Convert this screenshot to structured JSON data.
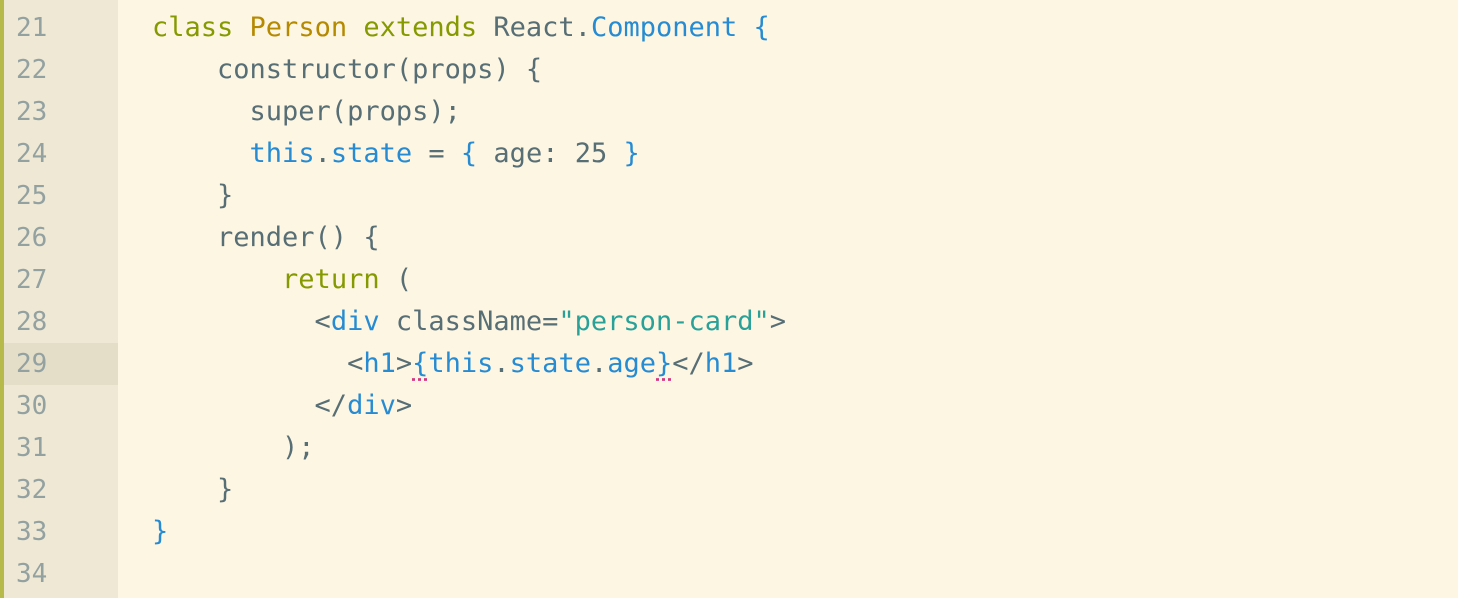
{
  "editor": {
    "colors": {
      "background": "#fdf6e3",
      "gutter": "#eee8d5",
      "active_line_gutter": "#e4ddc8",
      "gutter_accent": "#b5ba4a",
      "keyword": "#859900",
      "class_name": "#b58900",
      "identifier_blue": "#268bd2",
      "string": "#2aa198",
      "plain": "#586e75",
      "line_number": "#93a1a1",
      "lint_squiggle": "#d33682"
    },
    "active_line": 29,
    "lines": [
      {
        "number": "21",
        "tokens": [
          {
            "t": "class",
            "k": "keyword"
          },
          {
            "t": " ",
            "k": "plain"
          },
          {
            "t": "Person",
            "k": "class"
          },
          {
            "t": " ",
            "k": "plain"
          },
          {
            "t": "extends",
            "k": "keyword"
          },
          {
            "t": " React.",
            "k": "plain"
          },
          {
            "t": "Component",
            "k": "type"
          },
          {
            "t": " ",
            "k": "plain"
          },
          {
            "t": "{",
            "k": "brace"
          }
        ]
      },
      {
        "number": "22",
        "tokens": [
          {
            "t": "    constructor(props) {",
            "k": "plain"
          }
        ]
      },
      {
        "number": "23",
        "tokens": [
          {
            "t": "      super(props);",
            "k": "plain"
          }
        ]
      },
      {
        "number": "24",
        "tokens": [
          {
            "t": "      ",
            "k": "plain"
          },
          {
            "t": "this",
            "k": "this"
          },
          {
            "t": ".",
            "k": "plain"
          },
          {
            "t": "state",
            "k": "prop"
          },
          {
            "t": " = ",
            "k": "plain"
          },
          {
            "t": "{",
            "k": "brace"
          },
          {
            "t": " age: 25 ",
            "k": "plain"
          },
          {
            "t": "}",
            "k": "brace"
          }
        ]
      },
      {
        "number": "25",
        "tokens": [
          {
            "t": "    }",
            "k": "plain"
          }
        ]
      },
      {
        "number": "26",
        "tokens": [
          {
            "t": "    render() {",
            "k": "plain"
          }
        ]
      },
      {
        "number": "27",
        "tokens": [
          {
            "t": "        ",
            "k": "plain"
          },
          {
            "t": "return",
            "k": "keyword"
          },
          {
            "t": " (",
            "k": "plain"
          }
        ]
      },
      {
        "number": "28",
        "tokens": [
          {
            "t": "          <",
            "k": "plain"
          },
          {
            "t": "div",
            "k": "tag"
          },
          {
            "t": " className=",
            "k": "plain"
          },
          {
            "t": "\"person-card\"",
            "k": "string"
          },
          {
            "t": ">",
            "k": "plain"
          }
        ]
      },
      {
        "number": "29",
        "tokens": [
          {
            "t": "            <",
            "k": "plain"
          },
          {
            "t": "h1",
            "k": "tag"
          },
          {
            "t": ">",
            "k": "plain"
          },
          {
            "t": "{",
            "k": "brace",
            "squiggle": true
          },
          {
            "t": "this",
            "k": "this"
          },
          {
            "t": ".",
            "k": "plain"
          },
          {
            "t": "state",
            "k": "prop"
          },
          {
            "t": ".",
            "k": "plain"
          },
          {
            "t": "age",
            "k": "prop"
          },
          {
            "t": "}",
            "k": "brace",
            "squiggle": true
          },
          {
            "t": "</",
            "k": "plain"
          },
          {
            "t": "h1",
            "k": "tag"
          },
          {
            "t": ">",
            "k": "plain"
          }
        ]
      },
      {
        "number": "30",
        "tokens": [
          {
            "t": "          </",
            "k": "plain"
          },
          {
            "t": "div",
            "k": "tag"
          },
          {
            "t": ">",
            "k": "plain"
          }
        ]
      },
      {
        "number": "31",
        "tokens": [
          {
            "t": "        );",
            "k": "plain"
          }
        ]
      },
      {
        "number": "32",
        "tokens": [
          {
            "t": "    }",
            "k": "plain"
          }
        ]
      },
      {
        "number": "33",
        "tokens": [
          {
            "t": "}",
            "k": "brace"
          }
        ]
      },
      {
        "number": "34",
        "tokens": []
      }
    ]
  }
}
